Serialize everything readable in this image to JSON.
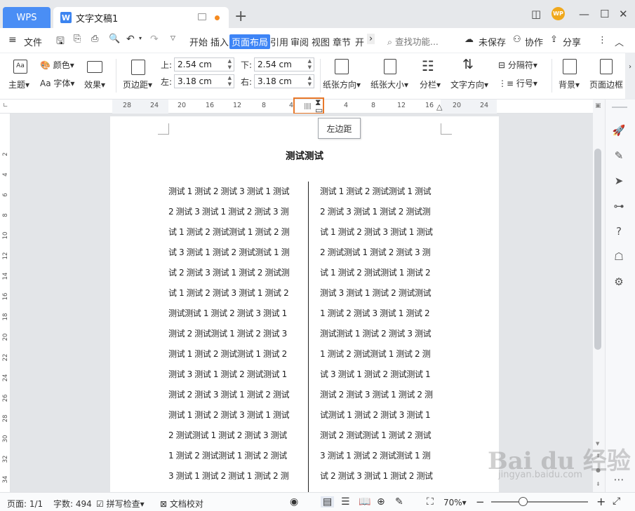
{
  "tabs": {
    "wps": "WPS",
    "document": "文字文稿1"
  },
  "avatar": "WP",
  "menu": {
    "file": "文件",
    "items": [
      "开始",
      "插入",
      "页面布局",
      "引用",
      "审阅",
      "视图",
      "章节",
      "开"
    ],
    "search": "查找功能...",
    "unsaved": "未保存",
    "collaborate": "协作",
    "share": "分享"
  },
  "ribbon": {
    "theme": "主题",
    "color": "颜色",
    "font": "Aa 字体",
    "effect": "效果",
    "margins": "页边距",
    "top_label": "上:",
    "top_value": "2.54 cm",
    "bottom_label": "下:",
    "bottom_value": "2.54 cm",
    "left_label": "左:",
    "left_value": "3.18 cm",
    "right_label": "右:",
    "right_value": "3.18 cm",
    "orientation": "纸张方向",
    "size": "纸张大小",
    "columns": "分栏",
    "text_direction": "文字方向",
    "separator": "分隔符",
    "line_number": "行号",
    "background": "背景",
    "page_border": "页面边框"
  },
  "ruler": {
    "ticks": [
      "28",
      "24",
      "20",
      "16",
      "12",
      "8",
      "4",
      "4",
      "8",
      "12",
      "16",
      "20",
      "24"
    ],
    "tooltip": "左边距"
  },
  "vruler": {
    "ticks": [
      "2",
      "4",
      "6",
      "8",
      "10",
      "12",
      "14",
      "16",
      "18",
      "20",
      "22",
      "24",
      "26",
      "28",
      "30",
      "32",
      "34"
    ]
  },
  "document": {
    "heading": "测试测试",
    "left_column": [
      "测试 1 测试 2 测试 3 测试 1 测试",
      "2 测试 3 测试 1 测试 2 测试 3 测",
      "试 1 测试 2 测试测试 1 测试 2 测",
      "试 3 测试 1 测试 2 测试测试 1 测",
      "试 2 测试 3 测试 1 测试 2 测试测",
      "试 1 测试 2 测试 3 测试 1 测试 2",
      "测试测试 1 测试 2 测试 3 测试 1",
      "测试 2 测试测试 1 测试 2 测试 3",
      "测试 1 测试 2 测试测试 1 测试 2",
      "测试 3 测试 1 测试 2 测试测试 1",
      "测试 2 测试 3 测试 1 测试 2 测试",
      "测试 1 测试 2 测试 3 测试 1 测试",
      "2 测试测试 1 测试 2 测试 3 测试",
      "1 测试 2 测试测试 1 测试 2 测试",
      "3 测试 1 测试 2 测试 1 测试 2 测"
    ],
    "right_column": [
      "测试 1 测试 2 测试测试 1 测试",
      "2 测试 3 测试 1 测试 2 测试测",
      "试 1 测试 2 测试 3 测试 1 测试",
      "2 测试测试 1 测试 2 测试 3 测",
      "试 1 测试 2 测试测试 1 测试 2",
      "测试 3 测试 1 测试 2 测试测试",
      "1 测试 2 测试 3 测试 1 测试 2",
      "测试测试 1 测试 2 测试 3 测试",
      "1 测试 2 测试测试 1 测试 2 测",
      "试 3 测试 1 测试 2 测试测试 1",
      "测试 2 测试 3 测试 1 测试 2 测",
      "试测试 1 测试 2 测试 3 测试 1",
      "测试 2 测试测试 1 测试 2 测试",
      "3 测试 1 测试 2 测试测试 1 测",
      "试 2 测试 3 测试 1 测试 2 测试"
    ]
  },
  "status": {
    "page": "页面: 1/1",
    "words": "字数: 494",
    "spell": "拼写检查",
    "proof": "文档校对",
    "zoom": "70%"
  },
  "watermark": {
    "brand": "Bai du 经验",
    "url": "jingyan.baidu.com"
  },
  "colors": {
    "accent": "#3d84f6",
    "highlight": "#e8782a",
    "wps_tab": "#4a8ef5"
  }
}
